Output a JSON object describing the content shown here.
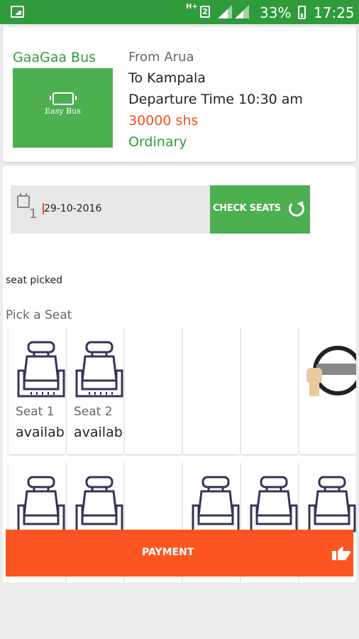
{
  "status_bar": {
    "network": "H+",
    "sim": "2",
    "battery": "33%",
    "time": "17:25"
  },
  "bus": {
    "name": "GaaGaa Bus",
    "logo_text": "Easy Bus",
    "from": "From Arua",
    "to": "To Kampala",
    "departure": "Departure Time 10:30 am",
    "price": "30000 shs",
    "class": "Ordinary"
  },
  "booking": {
    "calendar_digit": "1",
    "date": "29-10-2016",
    "check_seats_label": "CHECK SEATS",
    "seat_picked": "seat picked",
    "pick_title": "Pick a Seat"
  },
  "seats_row1": [
    {
      "label": "Seat 1",
      "status": "available"
    },
    {
      "label": "Seat 2",
      "status": "available"
    }
  ],
  "payment": {
    "label": "PAYMENT"
  },
  "colors": {
    "brand_green": "#2f9b3b",
    "accent_orange": "#fc5521",
    "button_green": "#4caf50"
  }
}
